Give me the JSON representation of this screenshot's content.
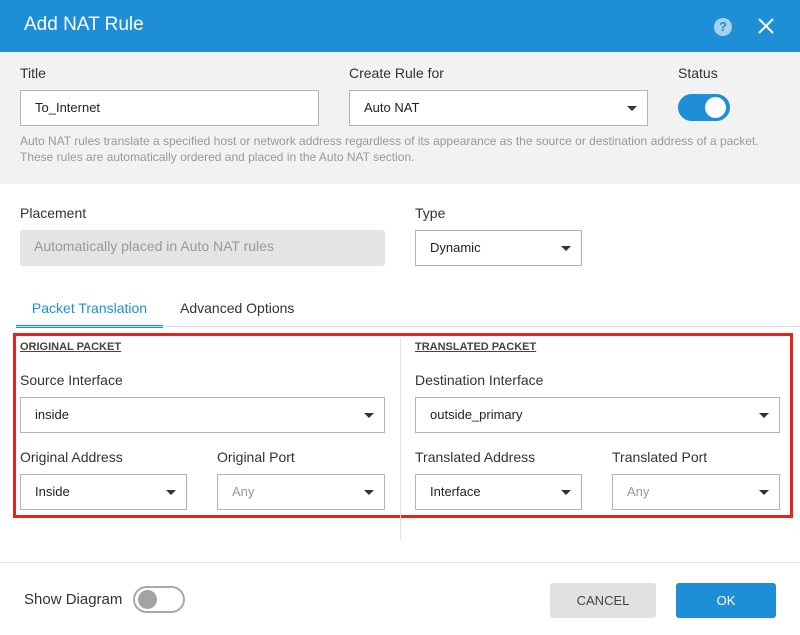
{
  "dialog": {
    "title": "Add NAT Rule",
    "help_icon": "?",
    "close_icon": "close-icon"
  },
  "form": {
    "title_label": "Title",
    "title_value": "To_Internet",
    "create_rule_label": "Create Rule for",
    "create_rule_value": "Auto NAT",
    "status_label": "Status",
    "status_enabled": true,
    "note": "Auto NAT rules translate a specified host or network address regardless of its appearance as the source or destination address of a packet. These rules are automatically ordered and placed in the Auto NAT section.",
    "placement_label": "Placement",
    "placement_value": "Automatically placed in Auto NAT rules",
    "type_label": "Type",
    "type_value": "Dynamic"
  },
  "tabs": [
    {
      "label": "Packet Translation",
      "active": true
    },
    {
      "label": "Advanced Options",
      "active": false
    }
  ],
  "original": {
    "header": "ORIGINAL PACKET",
    "source_interface_label": "Source Interface",
    "source_interface_value": "inside",
    "address_label": "Original Address",
    "address_value": "Inside",
    "port_label": "Original Port",
    "port_placeholder": "Any"
  },
  "translated": {
    "header": "TRANSLATED PACKET",
    "destination_interface_label": "Destination Interface",
    "destination_interface_value": "outside_primary",
    "address_label": "Translated Address",
    "address_value": "Interface",
    "port_label": "Translated Port",
    "port_placeholder": "Any"
  },
  "footer": {
    "show_diagram_label": "Show Diagram",
    "show_diagram_enabled": false,
    "cancel_label": "CANCEL",
    "ok_label": "OK"
  },
  "colors": {
    "accent": "#1e8fd6",
    "highlight": "#e8231a"
  }
}
